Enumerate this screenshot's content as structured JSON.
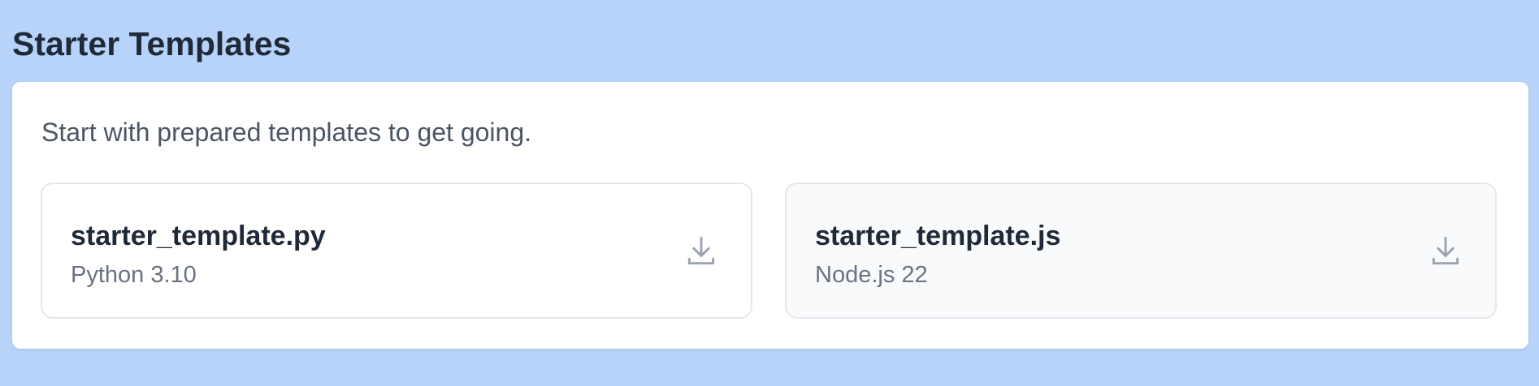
{
  "page": {
    "title": "Starter Templates"
  },
  "panel": {
    "description": "Start with prepared templates to get going."
  },
  "templates": [
    {
      "name": "starter_template.py",
      "runtime": "Python 3.10",
      "icon": "download-icon"
    },
    {
      "name": "starter_template.js",
      "runtime": "Node.js 22",
      "icon": "download-icon"
    }
  ],
  "colors": {
    "page_background": "#b8d3fa",
    "panel_background": "#ffffff",
    "title_text": "#1f2937",
    "muted_text": "#6b7280",
    "icon": "#9ca3af",
    "card_border": "#e5e7eb",
    "hovered_card_background": "#f8fafc"
  }
}
